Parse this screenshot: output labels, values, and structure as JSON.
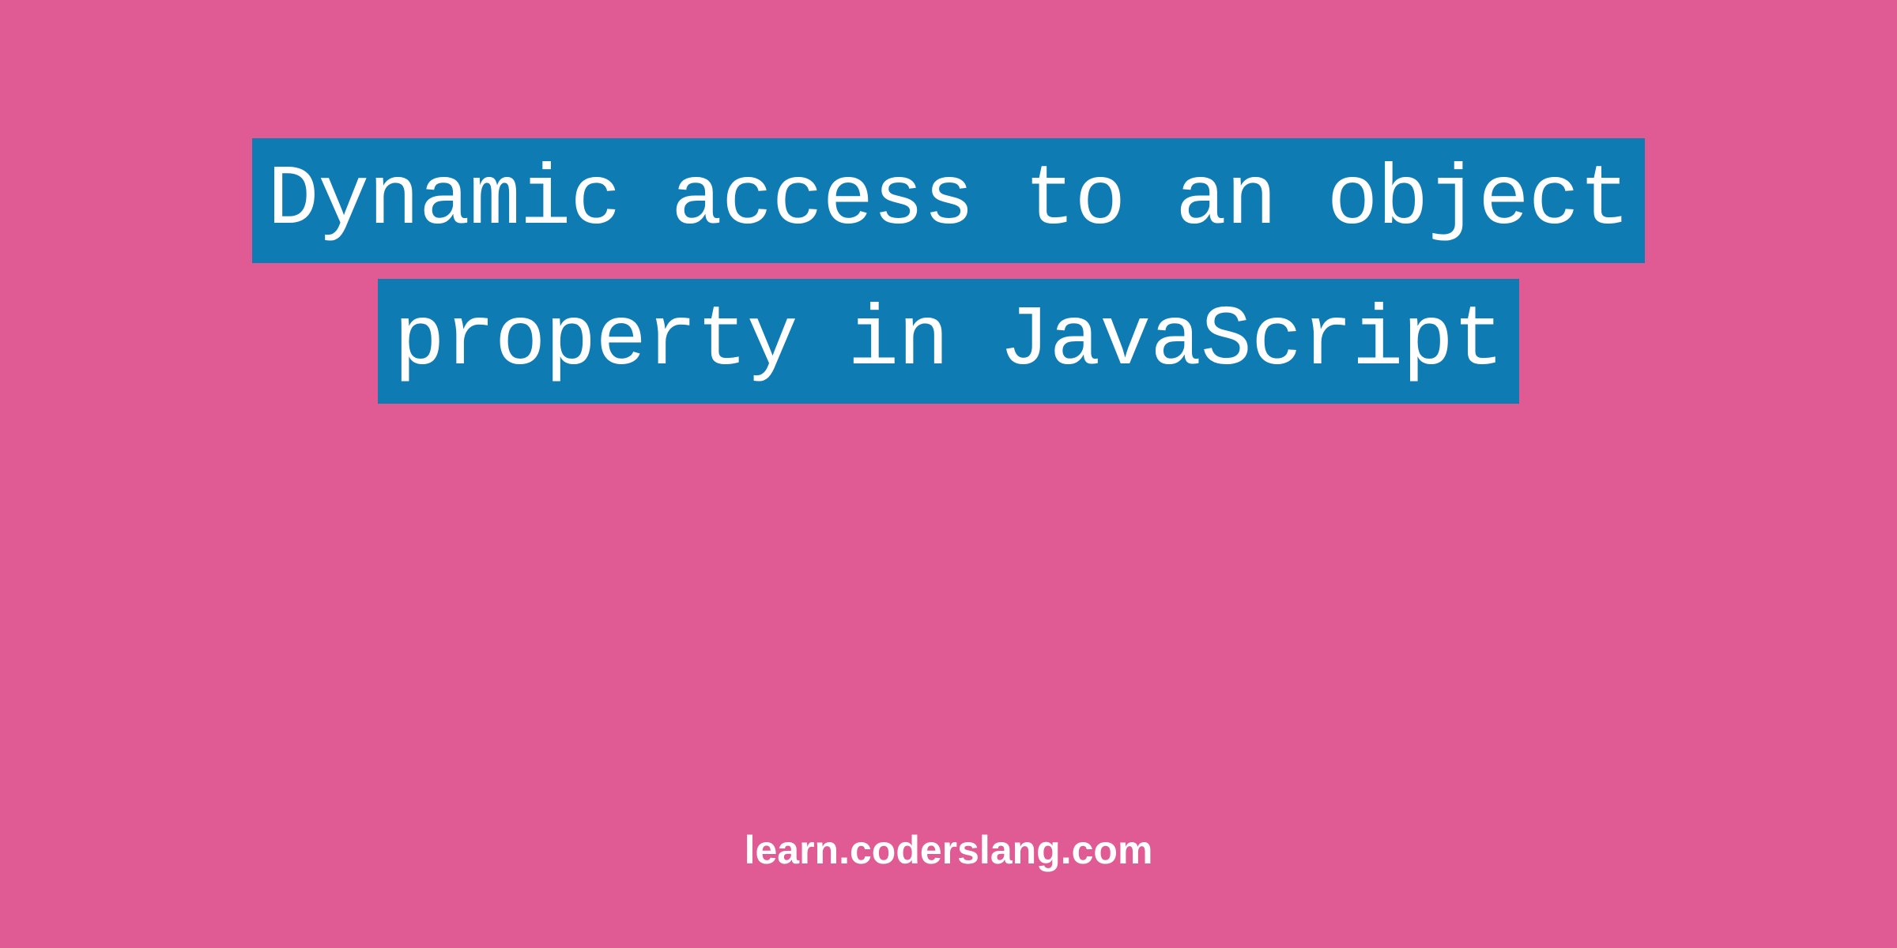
{
  "colors": {
    "background": "#e05a93",
    "highlight": "#0e7bb3",
    "text": "#ffffff"
  },
  "title": {
    "text": "Dynamic access to an object property in JavaScript"
  },
  "footer": {
    "link": "learn.coderslang.com"
  }
}
